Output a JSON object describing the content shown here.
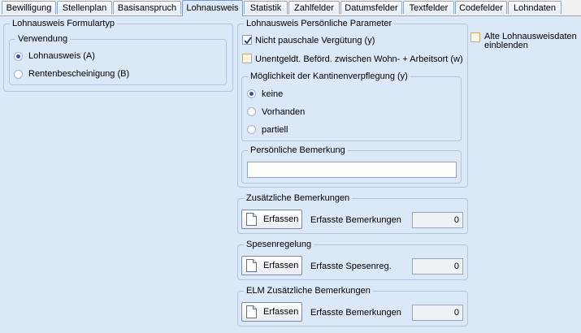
{
  "tabs": [
    {
      "label": "Bewilligung"
    },
    {
      "label": "Stellenplan"
    },
    {
      "label": "Basisanspruch"
    },
    {
      "label": "Lohnausweis"
    },
    {
      "label": "Statistik"
    },
    {
      "label": "Zahlfelder"
    },
    {
      "label": "Datumsfelder"
    },
    {
      "label": "Textfelder"
    },
    {
      "label": "Codefelder"
    },
    {
      "label": "Lohndaten"
    }
  ],
  "active_tab": "Lohnausweis",
  "formulartyp": {
    "title": "Lohnausweis Formulartyp",
    "verwendung": {
      "title": "Verwendung",
      "options": [
        {
          "label": "Lohnausweis (A)",
          "selected": true
        },
        {
          "label": "Rentenbescheinigung (B)",
          "selected": false
        }
      ]
    }
  },
  "parameter": {
    "title": "Lohnausweis Persönliche Parameter",
    "nicht_pauschale": {
      "label": "Nicht pauschale Vergütung (y)",
      "checked": true
    },
    "unentgeldt": {
      "label": "Unentgeldt. Beförd. zwischen Wohn- + Arbeitsort (w)",
      "checked": false
    },
    "kantine": {
      "title": "Möglichkeit der Kantinenverpflegung (y)",
      "options": [
        {
          "label": "keine",
          "selected": true
        },
        {
          "label": "Vorhanden",
          "selected": false
        },
        {
          "label": "partiell",
          "selected": false
        }
      ]
    },
    "bemerkung": {
      "title": "Persönliche Bemerkung",
      "value": ""
    }
  },
  "alte_lohnausweise": {
    "label_line1": "Alte Lohnausweisdaten",
    "label_line2": "einblenden",
    "checked": false
  },
  "zusaetzliche": {
    "title": "Zusätzliche Bemerkungen",
    "button": "Erfassen",
    "count_label": "Erfasste Bemerkungen",
    "count": "0"
  },
  "spesen": {
    "title": "Spesenregelung",
    "button": "Erfassen",
    "count_label": "Erfasste Spesenreg.",
    "count": "0"
  },
  "elm": {
    "title": "ELM Zusätzliche Bemerkungen",
    "button": "Erfassen",
    "count_label": "Erfasste Bemerkungen",
    "count": "0"
  }
}
